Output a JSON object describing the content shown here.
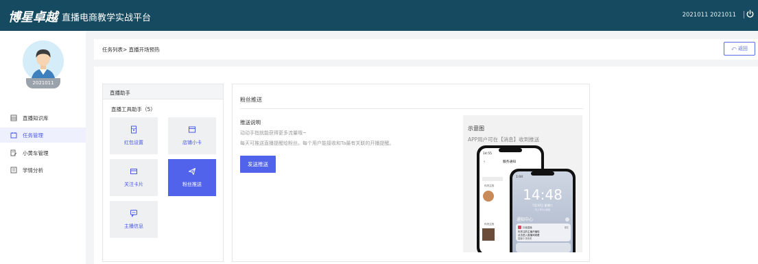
{
  "header": {
    "logo_brand": "博星卓越",
    "logo_sub": "直播电商教学实战平台",
    "user": "2021011 2021011"
  },
  "sidebar": {
    "avatar_label": "2021011",
    "items": [
      {
        "label": "直播知识库",
        "icon": "database-icon"
      },
      {
        "label": "任务管理",
        "icon": "task-icon",
        "active": true
      },
      {
        "label": "小黄车管理",
        "icon": "cart-manage-icon"
      },
      {
        "label": "学情分析",
        "icon": "chart-icon"
      }
    ]
  },
  "breadcrumb": {
    "text": "任务列表> 直播开场预热",
    "back": "返回"
  },
  "assistant": {
    "title": "直播助手",
    "tools_title": "直播工具助手（5）",
    "tools": [
      {
        "label": "红包设置",
        "icon": "red-packet-icon"
      },
      {
        "label": "店铺小卡",
        "icon": "shop-card-icon"
      },
      {
        "label": "关注卡片",
        "icon": "follow-card-icon"
      },
      {
        "label": "粉丝推送",
        "icon": "send-icon",
        "active": true
      },
      {
        "label": "主播信息",
        "icon": "anchor-info-icon"
      }
    ]
  },
  "push": {
    "title": "粉丝推送",
    "desc_title": "推送说明",
    "desc_line1": "动动手指就能获得更多流量哦~",
    "desc_line2": "每天可推送直播提醒给粉丝。每个用户能接收和Ta最有关联的开播提醒。",
    "send_button": "发送推送",
    "example_title": "示意图",
    "example_sub": "APP用户可在【消息】收到推送"
  },
  "phone": {
    "status_time": "14:55",
    "back_time": "1:04",
    "service_title": "服务通知",
    "clock": "14:48",
    "date": "7月30日 星期二",
    "unlock": "向上滑动以解锁",
    "notify_title": "通知中心",
    "notify_app": "抖音直播",
    "notify_time": "现在",
    "notify_line1": "你关注的主播开播啦",
    "notify_line2": "点击进入直播间观看",
    "notify_line3": "直播中 快来看",
    "list_name": "你关注的"
  },
  "colors": {
    "topbar": "#154a60",
    "accent": "#5063ea"
  }
}
